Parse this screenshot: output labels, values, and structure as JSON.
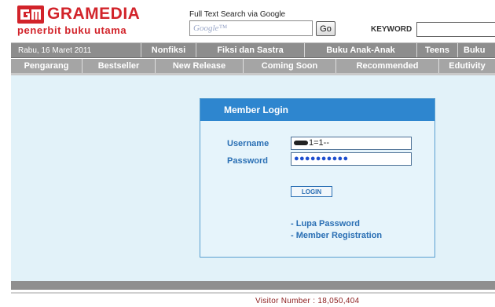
{
  "brand": {
    "name": "GRAMEDIA",
    "tagline": "penerbit buku utama",
    "logo_mark": "gm-logo",
    "color": "#d2232a"
  },
  "google_search": {
    "label": "Full Text Search via Google",
    "placeholder_logo": "Google™",
    "go_label": "Go"
  },
  "keyword": {
    "label": "KEYWORD",
    "value": ""
  },
  "nav_primary": {
    "date": "Rabu, 16 Maret 2011",
    "items": [
      "Nonfiksi",
      "Fiksi dan Sastra",
      "Buku Anak-Anak",
      "Teens",
      "Buku"
    ]
  },
  "nav_secondary": {
    "items": [
      "Pengarang",
      "Bestseller",
      "New Release",
      "Coming Soon",
      "Recommended",
      "Edutivity"
    ]
  },
  "login": {
    "title": "Member Login",
    "username_label": "Username",
    "username_value": "1=1--",
    "password_label": "Password",
    "password_dots": "●●●●●●●●●●",
    "button_label": "LOGIN",
    "forgot_link": "- Lupa Password",
    "register_link": "- Member Registration"
  },
  "footer": {
    "visitor_text": "Visitor Number : 18,050,404"
  },
  "colors": {
    "nav_primary_bg": "#8d8d8d",
    "nav_secondary_bg": "#a5a5a5",
    "main_bg": "#e2f2f9",
    "login_header": "#2e86cf",
    "link_color": "#2a6fb4"
  }
}
